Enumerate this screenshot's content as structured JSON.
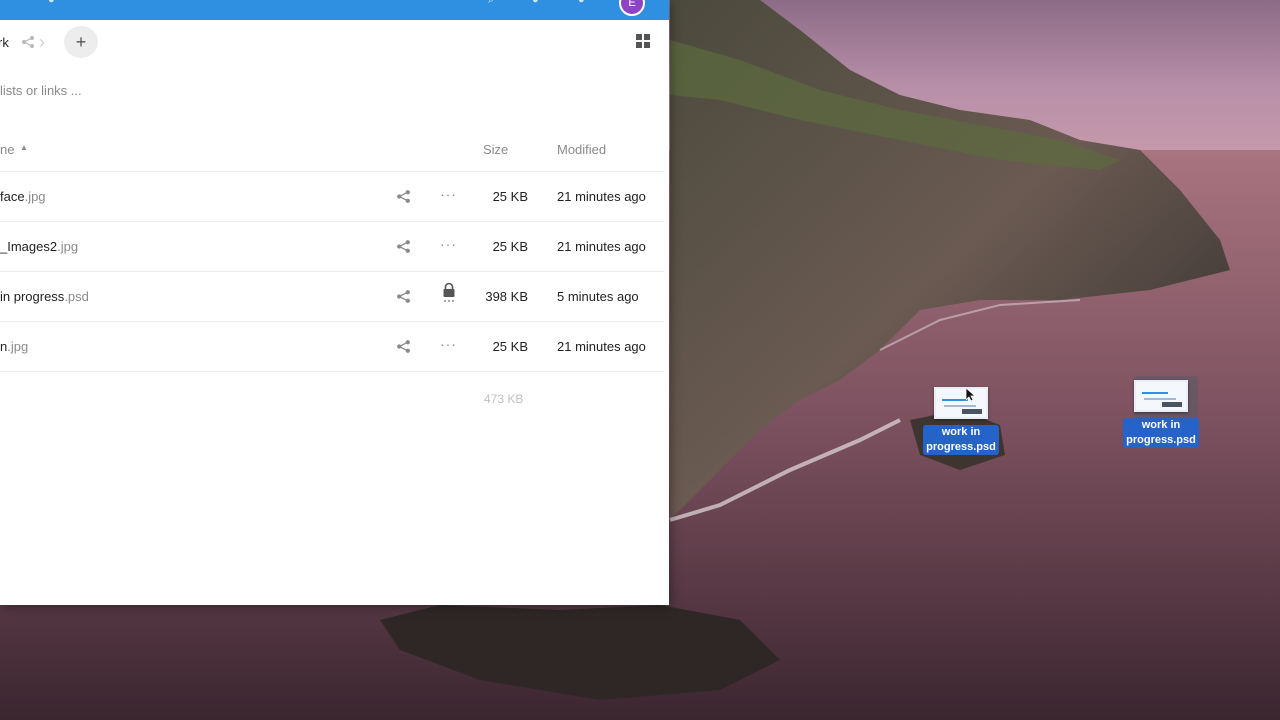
{
  "window": {
    "breadcrumb": "rk",
    "description_placeholder": "lists or links ...",
    "avatar_letter": "E"
  },
  "table": {
    "header_name": "ne",
    "header_size": "Size",
    "header_modified": "Modified",
    "rows": [
      {
        "name": "face",
        "ext": ".jpg",
        "size": "25 KB",
        "modified": "21 minutes ago",
        "locked": false
      },
      {
        "name": "_Images2",
        "ext": ".jpg",
        "size": "25 KB",
        "modified": "21 minutes ago",
        "locked": false
      },
      {
        "name": "in progress",
        "ext": ".psd",
        "size": "398 KB",
        "modified": "5 minutes ago",
        "locked": true
      },
      {
        "name": "n",
        "ext": ".jpg",
        "size": "25 KB",
        "modified": "21 minutes ago",
        "locked": false
      }
    ],
    "total_size": "473 KB"
  },
  "desktop": {
    "icon1_label_line1": "work in",
    "icon1_label_line2": "progress.psd",
    "icon2_label_line1": "work in",
    "icon2_label_line2": "progress.psd"
  },
  "colors": {
    "accent": "#2f8fe0",
    "label_selection": "#2563c9",
    "avatar": "#8e44c7"
  }
}
